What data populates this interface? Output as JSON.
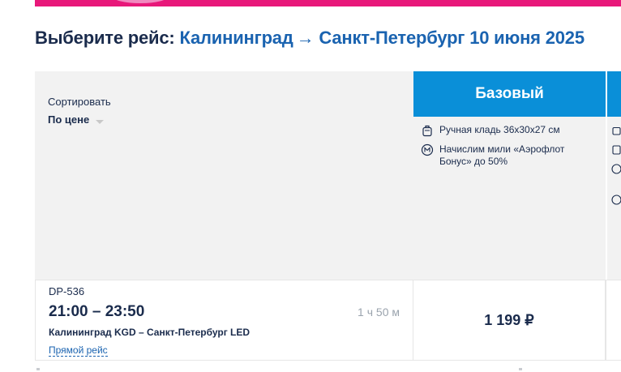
{
  "header": {
    "prefix": "Выберите рейс:",
    "origin": "Калининград",
    "arrow": "→",
    "destination": "Санкт-Петербург",
    "date": "10 июня 2025"
  },
  "sort": {
    "label": "Сортировать",
    "value": "По цене"
  },
  "tariffs": [
    {
      "name": "Базовый",
      "features": [
        {
          "icon": "carry-on-bag-icon",
          "text": "Ручная кладь 36x30x27 см"
        },
        {
          "icon": "miles-icon",
          "text": "Начислим мили «Аэрофлот Бонус» до 50%"
        }
      ]
    }
  ],
  "flight": {
    "number": "DP-536",
    "times": "21:00 – 23:50",
    "duration": "1 ч 50 м",
    "route": "Калининград KGD – Санкт-Петербург LED",
    "type": "Прямой рейс",
    "price": "1 199 ₽"
  },
  "colors": {
    "brand_pink": "#e8187a",
    "tariff_blue": "#0a8fd8",
    "headline_blue": "#1a63b0",
    "text_dark": "#1a2b4c"
  }
}
